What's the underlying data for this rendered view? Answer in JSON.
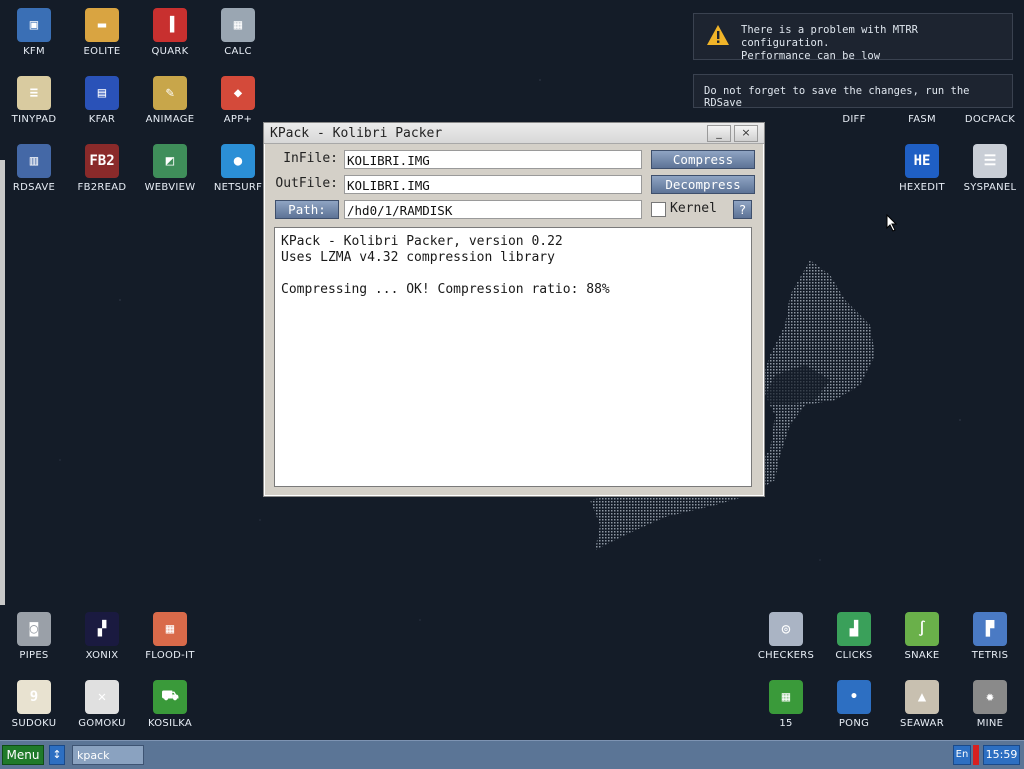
{
  "desktop_icons": [
    {
      "label": "KFM",
      "icon": "floppy-icon",
      "color": "#3a6fb5",
      "glyph": "▣"
    },
    {
      "label": "EOLITE",
      "icon": "folder-icon",
      "color": "#d9a441",
      "glyph": "▬"
    },
    {
      "label": "QUARK",
      "icon": "book-icon",
      "color": "#c8302f",
      "glyph": "▐"
    },
    {
      "label": "CALC",
      "icon": "calculator-icon",
      "color": "#9aa6b2",
      "glyph": "▦"
    },
    {
      "label": "TINYPAD",
      "icon": "notepad-icon",
      "color": "#d9cba0",
      "glyph": "≡"
    },
    {
      "label": "KFAR",
      "icon": "kfar-icon",
      "color": "#2a52b8",
      "glyph": "▤"
    },
    {
      "label": "ANIMAGE",
      "icon": "paint-icon",
      "color": "#c8a64a",
      "glyph": "✎"
    },
    {
      "label": "APP+",
      "icon": "cube-icon",
      "color": "#d44a3a",
      "glyph": "◆"
    },
    {
      "label": "RDSAVE",
      "icon": "rdsave-icon",
      "color": "#4468a6",
      "glyph": "▥"
    },
    {
      "label": "FB2READ",
      "icon": "fb2-book-icon",
      "color": "#8a2a2a",
      "glyph": "FB2"
    },
    {
      "label": "WEBVIEW",
      "icon": "webview-icon",
      "color": "#3f8e5a",
      "glyph": "◩"
    },
    {
      "label": "NETSURF",
      "icon": "globe-icon",
      "color": "#2b8fd6",
      "glyph": "●"
    },
    {
      "label": "DIFF",
      "icon": "diff-icon",
      "color": "",
      "glyph": ""
    },
    {
      "label": "FASM",
      "icon": "fasm-icon",
      "color": "",
      "glyph": ""
    },
    {
      "label": "DOCPACK",
      "icon": "docpack-icon",
      "color": "",
      "glyph": ""
    },
    {
      "label": "HEXEDIT",
      "icon": "hexedit-icon",
      "color": "#1f5fc4",
      "glyph": "HE"
    },
    {
      "label": "SYSPANEL",
      "icon": "sliders-icon",
      "color": "#c9ced6",
      "glyph": "☰"
    },
    {
      "label": "PIPES",
      "icon": "pipes-icon",
      "color": "#9aa0a8",
      "glyph": "◙"
    },
    {
      "label": "XONIX",
      "icon": "xonix-icon",
      "color": "#1a1a40",
      "glyph": "▞"
    },
    {
      "label": "FLOOD-IT",
      "icon": "flood-icon",
      "color": "#d96a4a",
      "glyph": "▦"
    },
    {
      "label": "SUDOKU",
      "icon": "sudoku-icon",
      "color": "#e8e2d0",
      "glyph": "9"
    },
    {
      "label": "GOMOKU",
      "icon": "gomoku-icon",
      "color": "#e0e0e0",
      "glyph": "✕"
    },
    {
      "label": "KOSILKA",
      "icon": "lawnmower-icon",
      "color": "#3a9a3a",
      "glyph": "⛟"
    },
    {
      "label": "CHECKERS",
      "icon": "checkers-icon",
      "color": "#aab4c4",
      "glyph": "◎"
    },
    {
      "label": "CLICKS",
      "icon": "clicks-icon",
      "color": "#3aa05a",
      "glyph": "▟"
    },
    {
      "label": "SNAKE",
      "icon": "snake-icon",
      "color": "#6ab04a",
      "glyph": "∫"
    },
    {
      "label": "TETRIS",
      "icon": "tetris-icon",
      "color": "#4a7ac4",
      "glyph": "▛"
    },
    {
      "label": "15",
      "icon": "fifteen-icon",
      "color": "#3a9a3a",
      "glyph": "▦"
    },
    {
      "label": "PONG",
      "icon": "pong-icon",
      "color": "#2d6fc2",
      "glyph": "•"
    },
    {
      "label": "SEAWAR",
      "icon": "seawar-icon",
      "color": "#c8c0b0",
      "glyph": "▲"
    },
    {
      "label": "MINE",
      "icon": "mine-icon",
      "color": "#8a8a8a",
      "glyph": "✹"
    }
  ],
  "notifications": {
    "mtrr": {
      "line1": "There is a problem with MTRR configuration.",
      "line2": "Performance can be low"
    },
    "rdsave": {
      "text": "Do not forget to save the changes, run the RDSave"
    }
  },
  "window": {
    "title": "KPack - Kolibri Packer",
    "min_label": "_",
    "close_label": "×",
    "infile_label": "InFile:",
    "infile_value": "KOLIBRI.IMG",
    "outfile_label": "OutFile:",
    "outfile_value": "KOLIBRI.IMG",
    "path_label": "Path:",
    "path_value": "/hd0/1/RAMDISK",
    "compress_label": "Compress",
    "decompress_label": "Decompress",
    "kernel_label": "Kernel",
    "help_label": "?",
    "log_lines": [
      "KPack - Kolibri Packer, version 0.22",
      "Uses LZMA v4.32 compression library",
      "",
      "Compressing ... OK! Compression ratio: 88%"
    ]
  },
  "taskbar": {
    "menu_label": "Menu",
    "switch_label": "↕",
    "task_label": "kpack",
    "lang_label": "En",
    "clock": "15:59"
  },
  "colors": {
    "accent": "#5b7596",
    "button": "#6d83a6",
    "menu": "#1f7a2a"
  }
}
